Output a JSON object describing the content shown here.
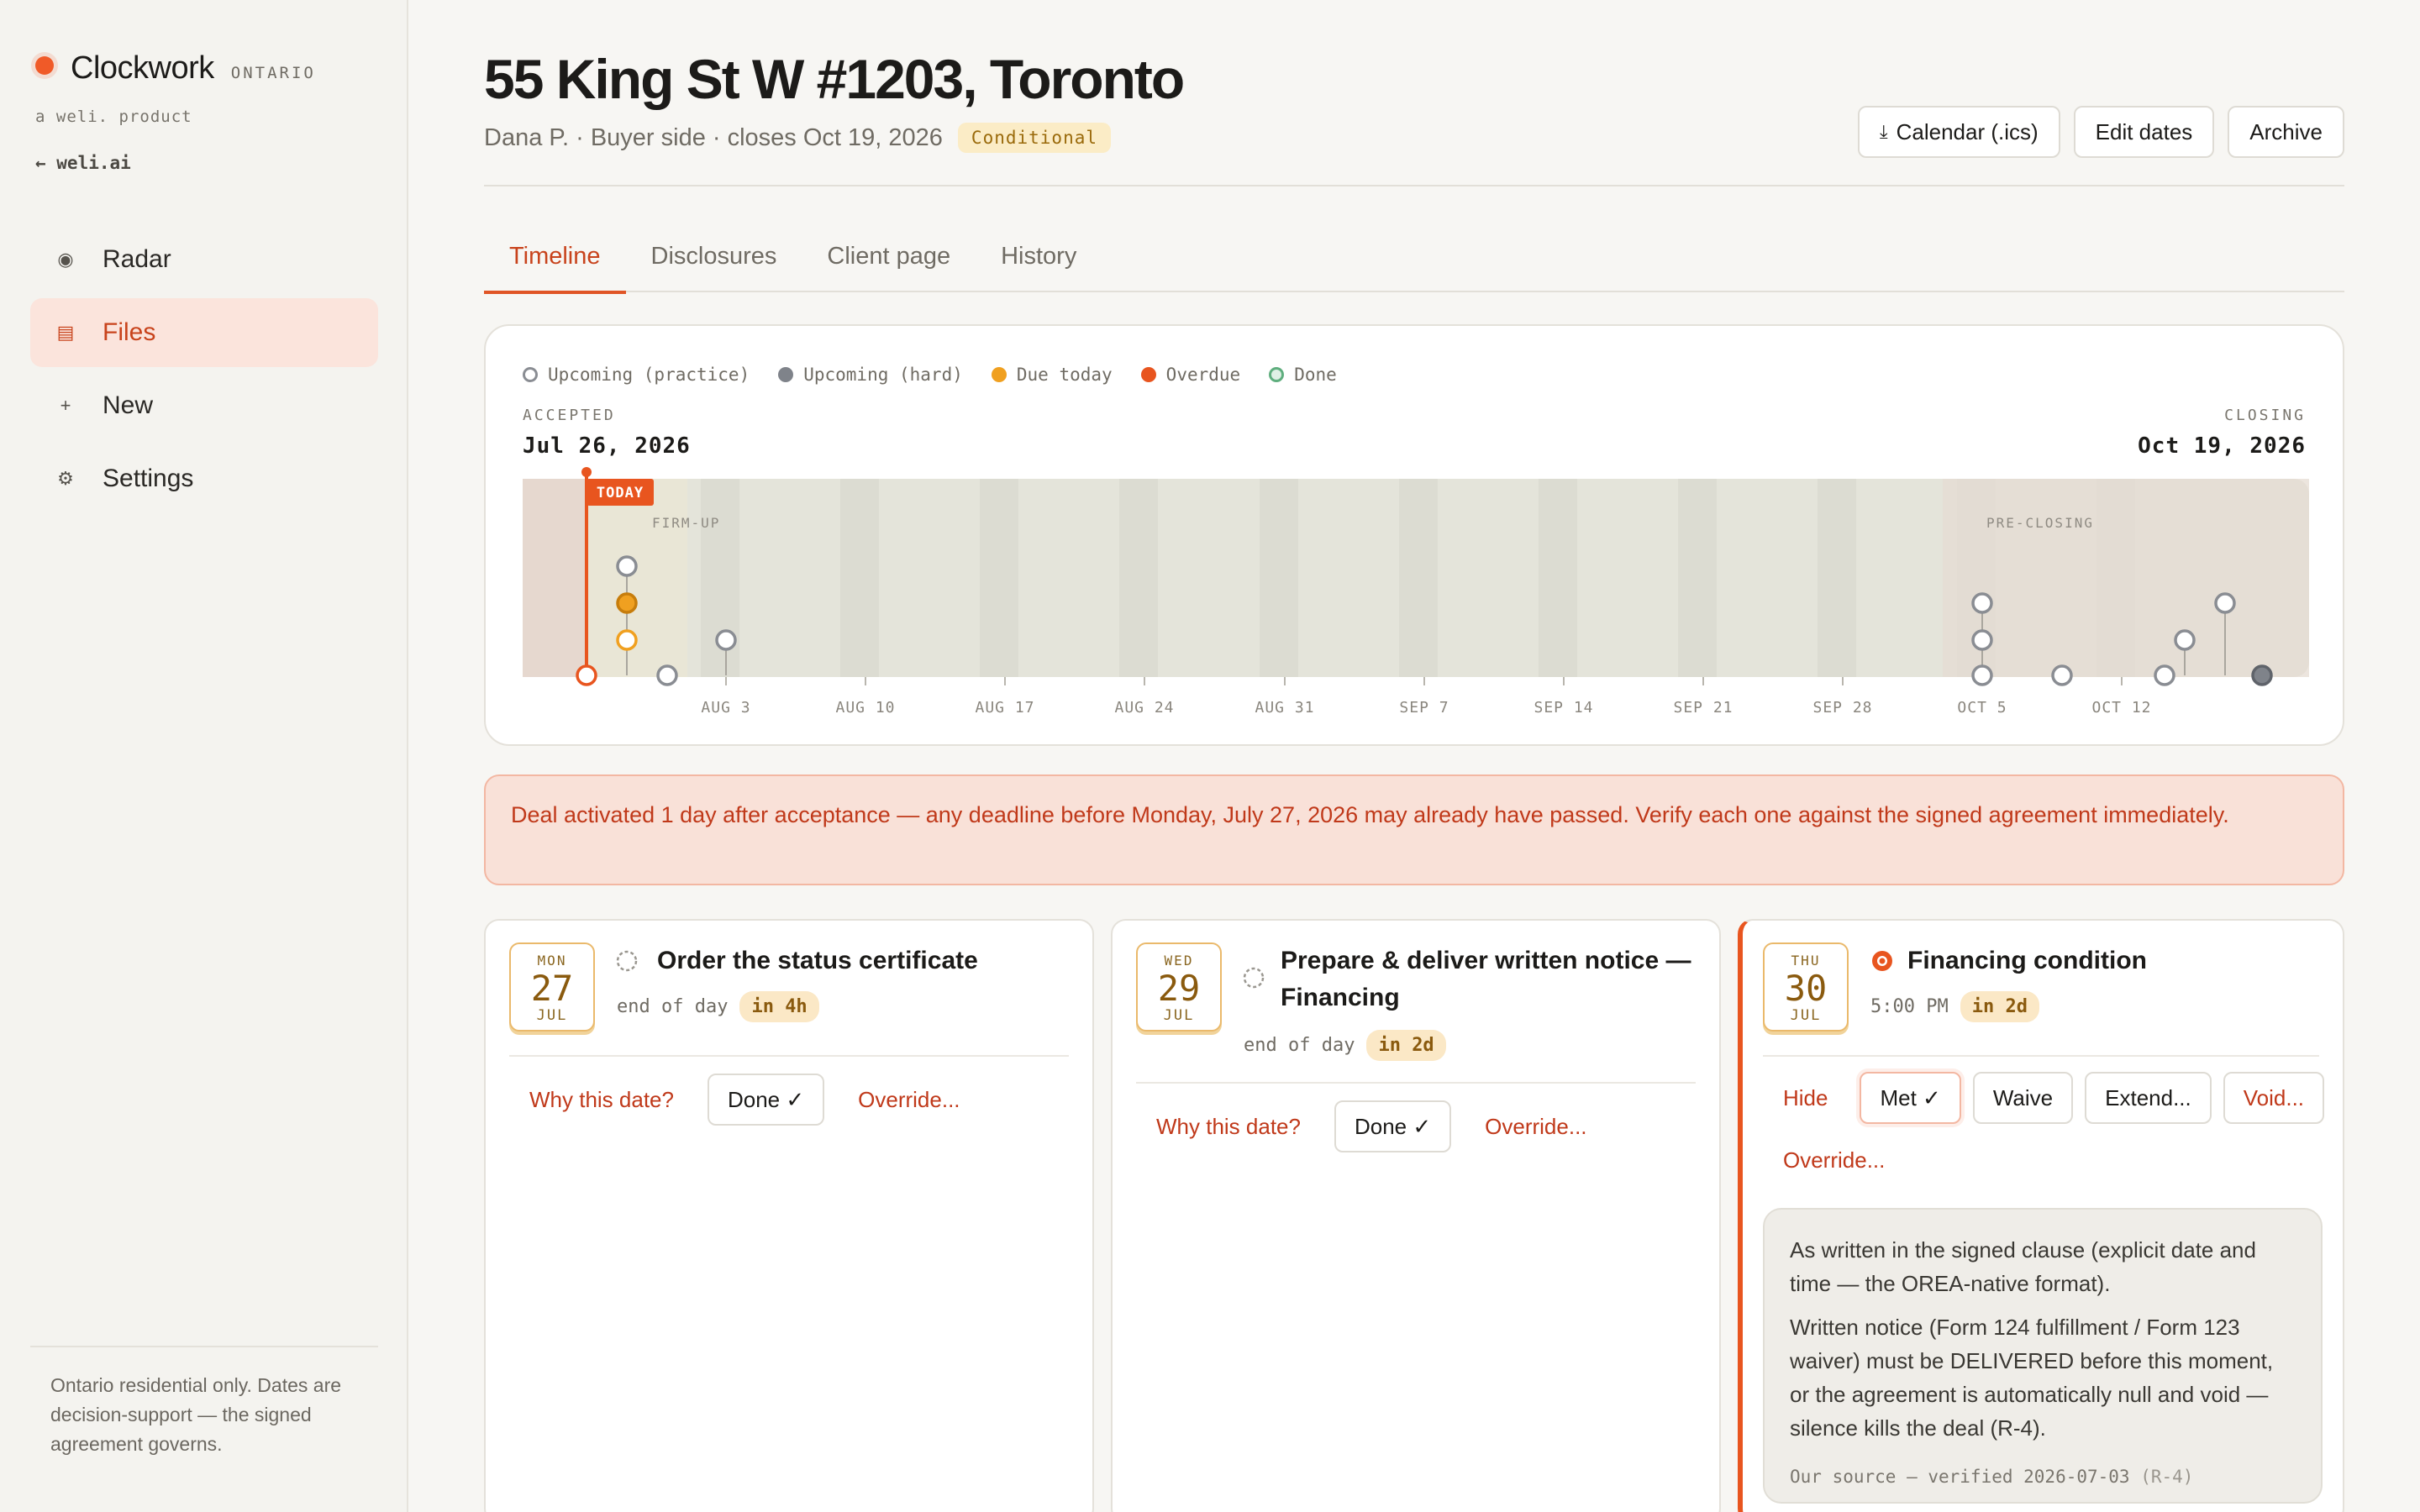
{
  "brand": {
    "name": "Clockwork",
    "region": "ONTARIO",
    "sub": "a weli. product",
    "link": "← weli.ai"
  },
  "nav": [
    {
      "label": "Radar",
      "icon": "radar-icon",
      "glyph": "◉"
    },
    {
      "label": "Files",
      "icon": "files-icon",
      "glyph": "▤"
    },
    {
      "label": "New",
      "icon": "plus-icon",
      "glyph": "+"
    },
    {
      "label": "Settings",
      "icon": "gear-icon",
      "glyph": "⚙"
    }
  ],
  "sidebar_footer": "Ontario residential only. Dates are decision-support — the signed agreement governs.",
  "header": {
    "title": "55 King St W #1203, Toronto",
    "subtitle": "Dana P. · Buyer side · closes Oct 19, 2026",
    "status_badge": "Conditional",
    "calendar_label": "Calendar (.ics)",
    "edit_label": "Edit dates",
    "archive_label": "Archive"
  },
  "tabs": [
    "Timeline",
    "Disclosures",
    "Client page",
    "History"
  ],
  "timeline": {
    "legend": [
      "Upcoming (practice)",
      "Upcoming (hard)",
      "Due today",
      "Overdue",
      "Done"
    ],
    "accepted_caption": "ACCEPTED",
    "accepted_date": "Jul 26, 2026",
    "closing_caption": "CLOSING",
    "closing_date": "Oct 19, 2026",
    "today_label": "TODAY",
    "zone_firmup": "FIRM-UP",
    "zone_preclosing": "PRE-CLOSING",
    "ticks": [
      "AUG 3",
      "AUG 10",
      "AUG 17",
      "AUG 24",
      "AUG 31",
      "SEP 7",
      "SEP 14",
      "SEP 21",
      "SEP 28",
      "OCT 5",
      "OCT 12"
    ]
  },
  "colors": {
    "accent": "#e8551f",
    "due": "#f0a020",
    "hard": "#7f838a",
    "done": "#5fae7e"
  },
  "alert": "Deal activated 1 day after acceptance — any deadline before Monday, July 27, 2026 may already have passed. Verify each one against the signed agreement immediately.",
  "cards": [
    {
      "dow": "MON",
      "day": "27",
      "month": "JUL",
      "title": "Order the status certificate",
      "time": "end of day",
      "due": "in 4h",
      "why": "Why this date?",
      "done": "Done ✓",
      "override": "Override..."
    },
    {
      "dow": "WED",
      "day": "29",
      "month": "JUL",
      "title": "Prepare & deliver written notice — Financing",
      "time": "end of day",
      "due": "in 2d",
      "why": "Why this date?",
      "done": "Done ✓",
      "override": "Override..."
    },
    {
      "dow": "THU",
      "day": "30",
      "month": "JUL",
      "title": "Financing condition",
      "time": "5:00 PM",
      "due": "in 2d",
      "hide": "Hide",
      "met": "Met ✓",
      "waive": "Waive",
      "extend": "Extend...",
      "void": "Void...",
      "override": "Override...",
      "note_p1": "As written in the signed clause (explicit date and time — the OREA-native format).",
      "note_p2": "Written notice (Form 124 fulfillment / Form 123 waiver) must be DELIVERED before this moment, or the agreement is automatically null and void — silence kills the deal (R-4).",
      "note_src": "Our source — verified 2026-07-03",
      "note_ref": "(R-4)"
    }
  ]
}
